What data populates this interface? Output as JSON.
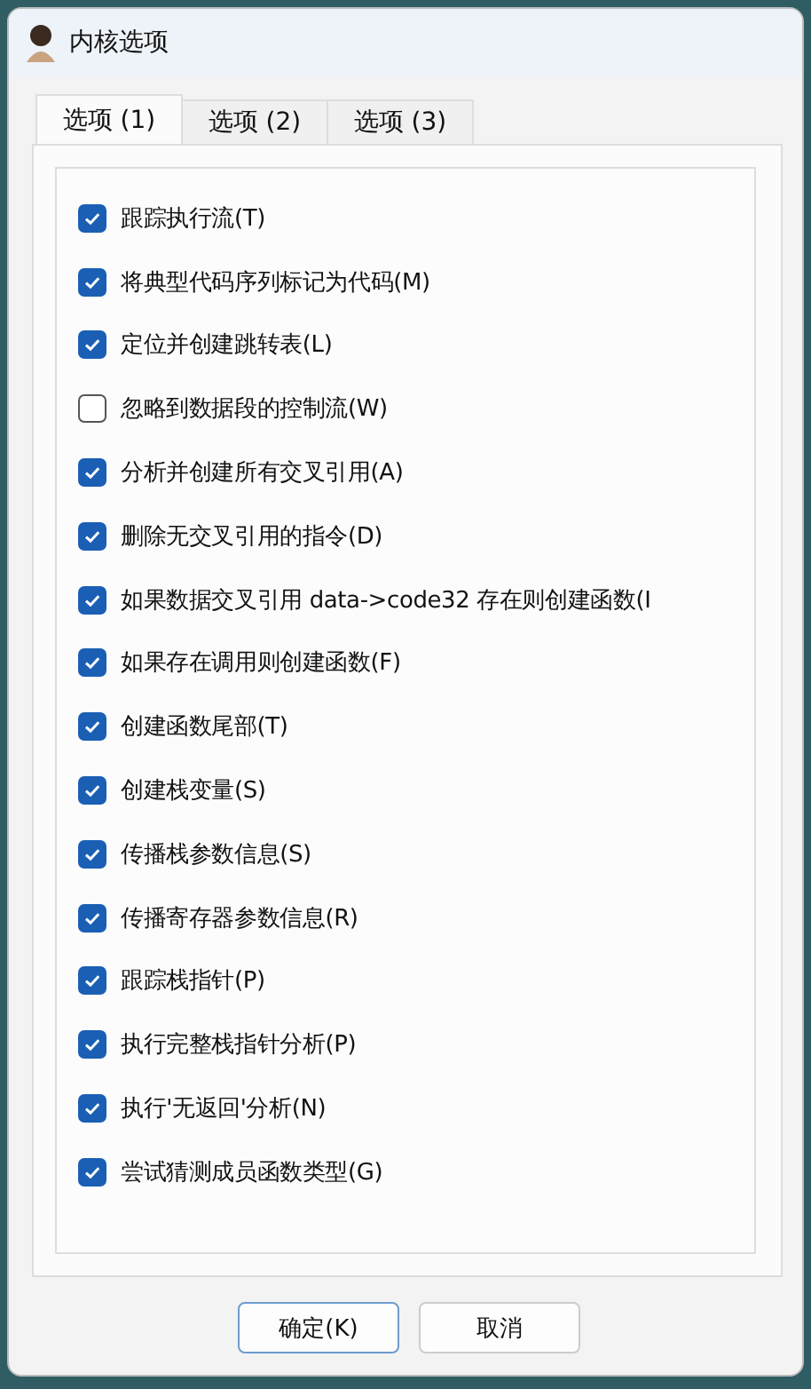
{
  "window": {
    "title": "内核选项"
  },
  "tabs": [
    {
      "label": "选项 (1)",
      "selected": true
    },
    {
      "label": "选项 (2)",
      "selected": false
    },
    {
      "label": "选项 (3)",
      "selected": false
    }
  ],
  "options": [
    {
      "label": "跟踪执行流(T)",
      "checked": true
    },
    {
      "label": "将典型代码序列标记为代码(M)",
      "checked": true
    },
    {
      "label": "定位并创建跳转表(L)",
      "checked": true
    },
    {
      "label": "忽略到数据段的控制流(W)",
      "checked": false
    },
    {
      "label": "分析并创建所有交叉引用(A)",
      "checked": true
    },
    {
      "label": "删除无交叉引用的指令(D)",
      "checked": true
    },
    {
      "label": "如果数据交叉引用 data->code32 存在则创建函数(I",
      "checked": true
    },
    {
      "label": "如果存在调用则创建函数(F)",
      "checked": true
    },
    {
      "label": "创建函数尾部(T)",
      "checked": true
    },
    {
      "label": "创建栈变量(S)",
      "checked": true
    },
    {
      "label": "传播栈参数信息(S)",
      "checked": true
    },
    {
      "label": "传播寄存器参数信息(R)",
      "checked": true
    },
    {
      "label": "跟踪栈指针(P)",
      "checked": true
    },
    {
      "label": "执行完整栈指针分析(P)",
      "checked": true
    },
    {
      "label": "执行'无返回'分析(N)",
      "checked": true
    },
    {
      "label": "尝试猜测成员函数类型(G)",
      "checked": true
    }
  ],
  "buttons": [
    {
      "label": "确定(K)",
      "kind": "default"
    },
    {
      "label": "取消",
      "kind": "normal"
    }
  ]
}
